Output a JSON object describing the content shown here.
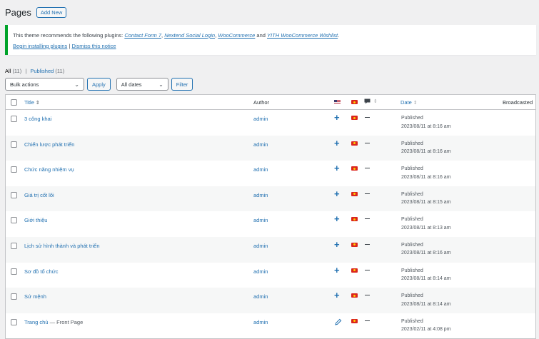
{
  "header": {
    "title": "Pages",
    "add_new": "Add New"
  },
  "notice": {
    "intro": "This theme recommends the following plugins: ",
    "plugins": [
      "Contact Form 7",
      "Nextend Social Login",
      "WooCommerce",
      "YITH WooCommerce Wishlist"
    ],
    "sep1": ", ",
    "and": " and ",
    "end": ".",
    "begin_link": "Begin installing plugins",
    "divider": " | ",
    "dismiss_link": "Dismiss this notice"
  },
  "views": {
    "all": "All",
    "all_count": "(11)",
    "sep": "|",
    "published": "Published",
    "published_count": "(11)"
  },
  "filters": {
    "bulk": "Bulk actions",
    "apply": "Apply",
    "dates": "All dates",
    "filter": "Filter"
  },
  "columns": {
    "title": "Title",
    "author": "Author",
    "date": "Date",
    "broadcasted": "Broadcasted"
  },
  "rows": [
    {
      "title": "3 công khai",
      "state": "",
      "author": "admin",
      "status": "Published",
      "date": "2023/08/11 at 8:16 am",
      "lang_icon": "plus"
    },
    {
      "title": "Chiến lược phát triển",
      "state": "",
      "author": "admin",
      "status": "Published",
      "date": "2023/08/11 at 8:16 am",
      "lang_icon": "plus"
    },
    {
      "title": "Chức năng nhiệm vụ",
      "state": "",
      "author": "admin",
      "status": "Published",
      "date": "2023/08/11 at 8:16 am",
      "lang_icon": "plus"
    },
    {
      "title": "Giá trị cốt lõi",
      "state": "",
      "author": "admin",
      "status": "Published",
      "date": "2023/08/11 at 8:15 am",
      "lang_icon": "plus"
    },
    {
      "title": "Giới thiệu",
      "state": "",
      "author": "admin",
      "status": "Published",
      "date": "2023/08/11 at 8:13 am",
      "lang_icon": "plus"
    },
    {
      "title": "Lịch sử hình thành và phát triển",
      "state": "",
      "author": "admin",
      "status": "Published",
      "date": "2023/08/11 at 8:16 am",
      "lang_icon": "plus"
    },
    {
      "title": "Sơ đồ tổ chức",
      "state": "",
      "author": "admin",
      "status": "Published",
      "date": "2023/08/11 at 8:14 am",
      "lang_icon": "plus"
    },
    {
      "title": "Sứ mệnh",
      "state": "",
      "author": "admin",
      "status": "Published",
      "date": "2023/08/11 at 8:14 am",
      "lang_icon": "plus"
    },
    {
      "title": "Trang chủ",
      "state": " — Front Page",
      "author": "admin",
      "status": "Published",
      "date": "2023/02/11 at 4:08 pm",
      "lang_icon": "pencil"
    }
  ],
  "colors": {
    "link": "#2271b1",
    "notice_border": "#00a32a",
    "vn_flag": "#da251d"
  }
}
